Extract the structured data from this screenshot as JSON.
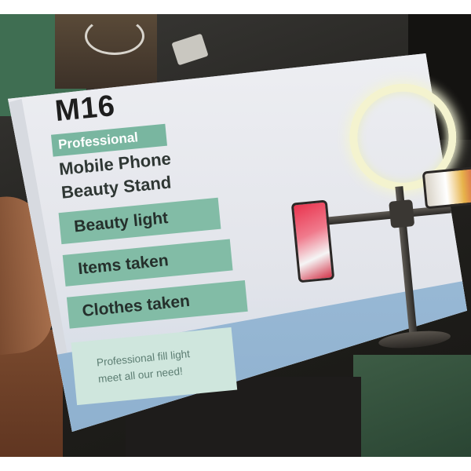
{
  "box": {
    "model": "M16",
    "tagline": "Professional",
    "product_name_line1": "Mobile Phone",
    "product_name_line2": "Beauty Stand",
    "features": [
      "Beauty light",
      "Items taken",
      "Clothes taken"
    ],
    "slogan_line1": "Professional fill light",
    "slogan_line2": "meet all our need!"
  },
  "colors": {
    "accent_green": "#82bca6",
    "light_green": "#cfe6dd",
    "box_white": "#e9eaee",
    "ring_light": "#f4f3cf",
    "blue_band": "#a5c3dd"
  }
}
